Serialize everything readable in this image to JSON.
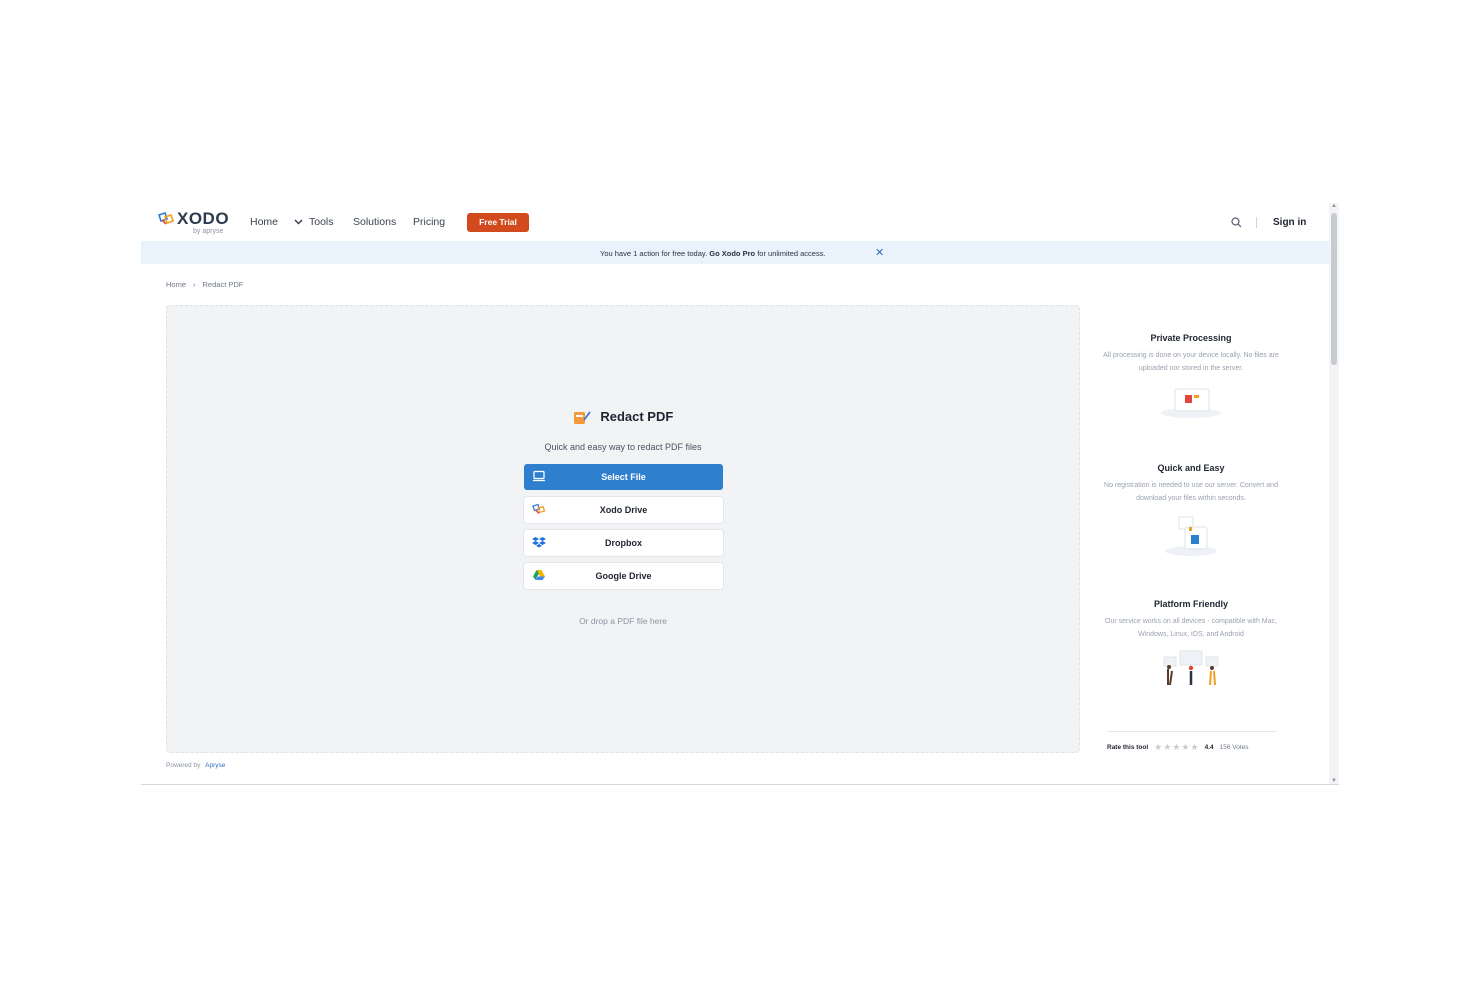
{
  "header": {
    "logo_text": "XODO",
    "logo_sub": "by apryse",
    "nav": {
      "home": "Home",
      "tools": "Tools",
      "solutions": "Solutions",
      "pricing": "Pricing"
    },
    "free_trial": "Free Trial",
    "sign_in": "Sign in"
  },
  "banner": {
    "text_before": "You have 1 action for free today.",
    "link": "Go Xodo Pro",
    "text_after": "for unlimited access.",
    "close": "✕"
  },
  "breadcrumb": {
    "home": "Home",
    "sep": "›",
    "current": "Redact PDF"
  },
  "tool": {
    "title": "Redact PDF",
    "subtitle": "Quick and easy way to redact PDF files",
    "buttons": {
      "select_file": "Select File",
      "xodo_drive": "Xodo Drive",
      "dropbox": "Dropbox",
      "google_drive": "Google Drive"
    },
    "drop_hint": "Or drop a PDF file here"
  },
  "sidebar": {
    "features": [
      {
        "title": "Private Processing",
        "text": "All processing is done on your device locally. No files are uploaded nor stored in the server."
      },
      {
        "title": "Quick and Easy",
        "text": "No registration is needed to use our server. Convert and download your files within seconds."
      },
      {
        "title": "Platform Friendly",
        "text": "Our service works on all devices - compatible with Mac, Windows, Linux, iOS, and Android"
      }
    ],
    "rating": {
      "label": "Rate this tool",
      "stars_filled": 0,
      "stars_total": 5,
      "score": "4.4",
      "votes": "156 Votes"
    }
  },
  "footer": {
    "powered_by": "Powered by",
    "brand": "Apryse"
  },
  "colors": {
    "accent": "#2f7fcf",
    "trial": "#d24b1f",
    "banner_bg": "#eaf2fb"
  }
}
